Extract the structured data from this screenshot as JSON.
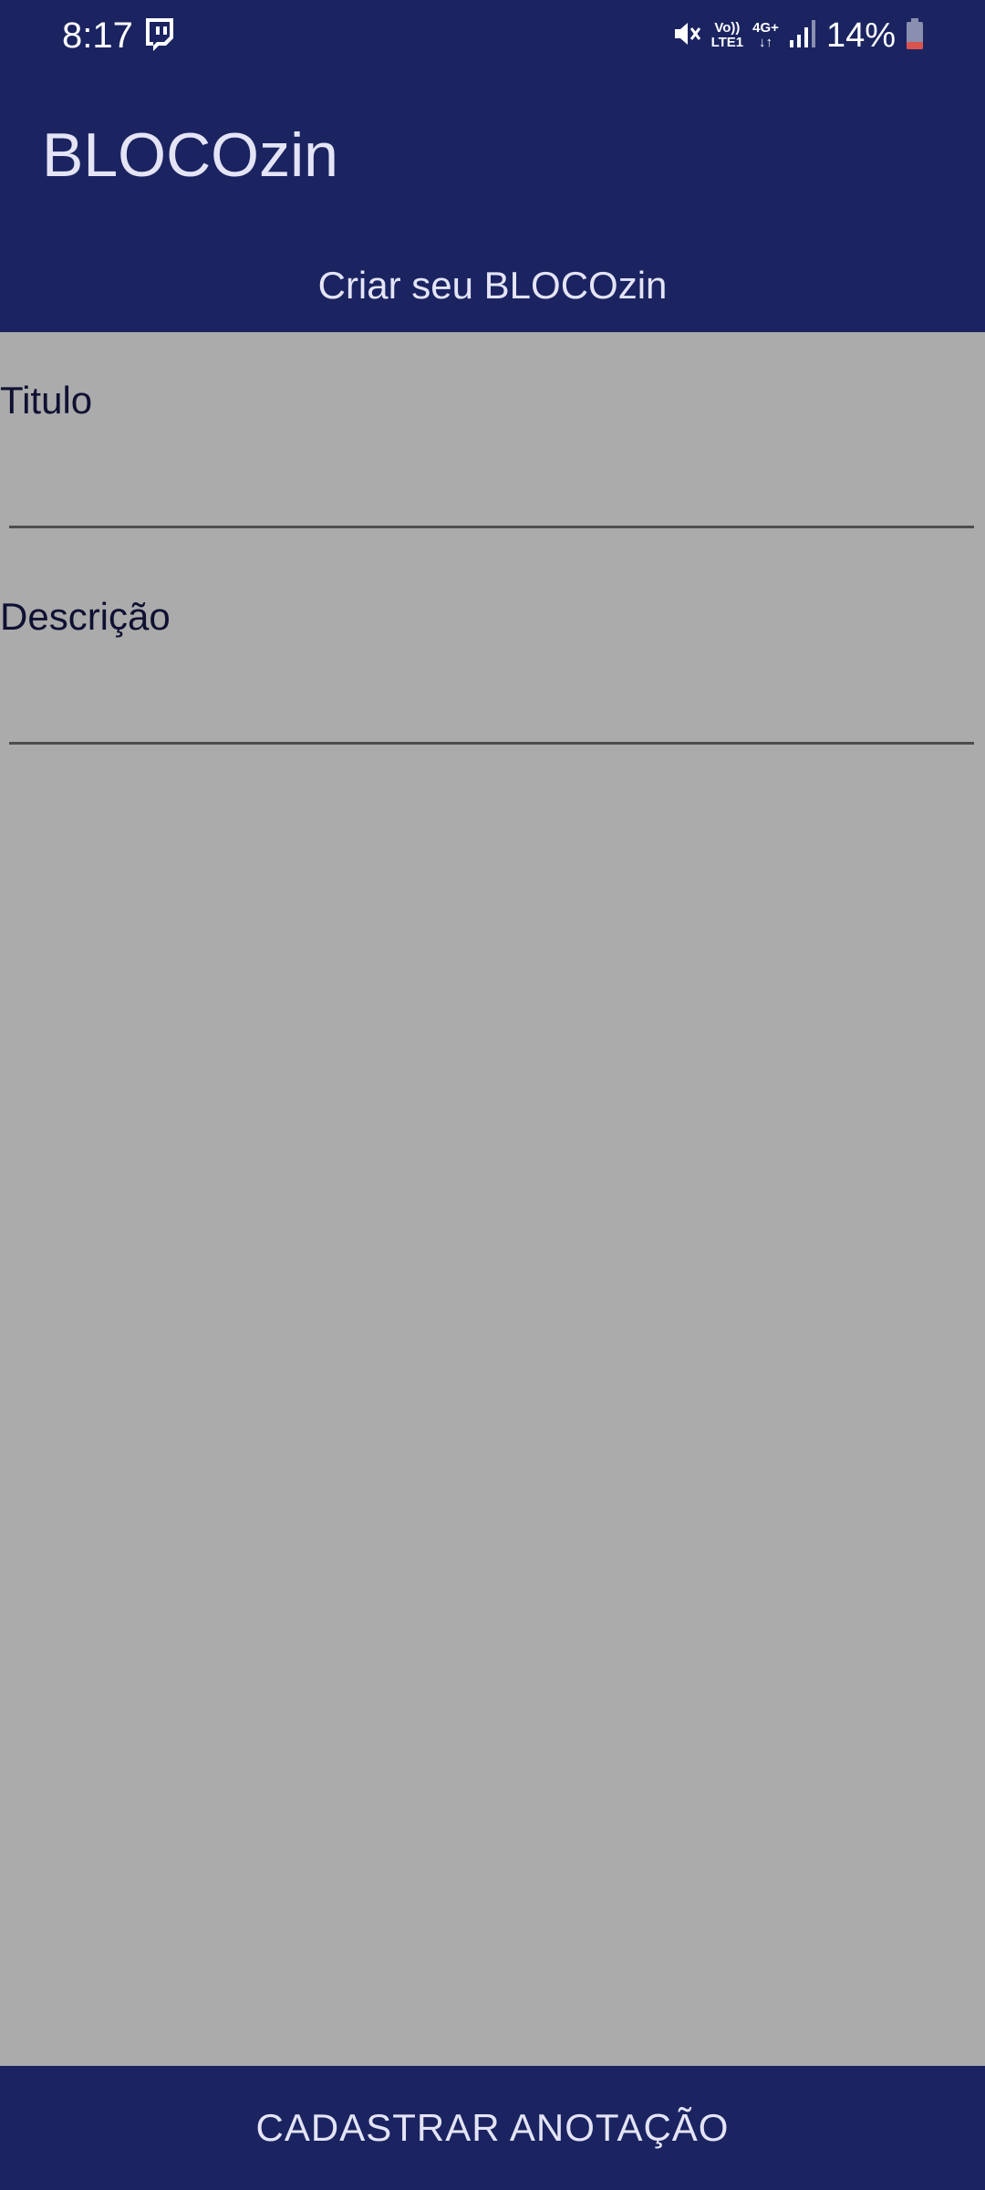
{
  "status_bar": {
    "time": "8:17",
    "volte_top": "Vo))",
    "volte_bottom": "LTE1",
    "network_top": "4G+",
    "network_bottom": "↓↑",
    "battery_percent": "14%",
    "icons": [
      "twitch-icon",
      "mute-icon",
      "signal-icon",
      "battery-icon"
    ],
    "battery_color": "#d9534f"
  },
  "header": {
    "app_title": "BLOCOzin",
    "subtitle": "Criar seu BLOCOzin"
  },
  "form": {
    "title_label": "Titulo",
    "title_value": "",
    "description_label": "Descrição",
    "description_value": ""
  },
  "footer": {
    "submit_label": "CADASTRAR ANOTAÇÃO"
  },
  "colors": {
    "primary": "#1b2461",
    "background": "#ababab",
    "on_primary_text": "#e4e4f6",
    "label_text": "#0f1133",
    "underline": "#4d4d4d"
  }
}
